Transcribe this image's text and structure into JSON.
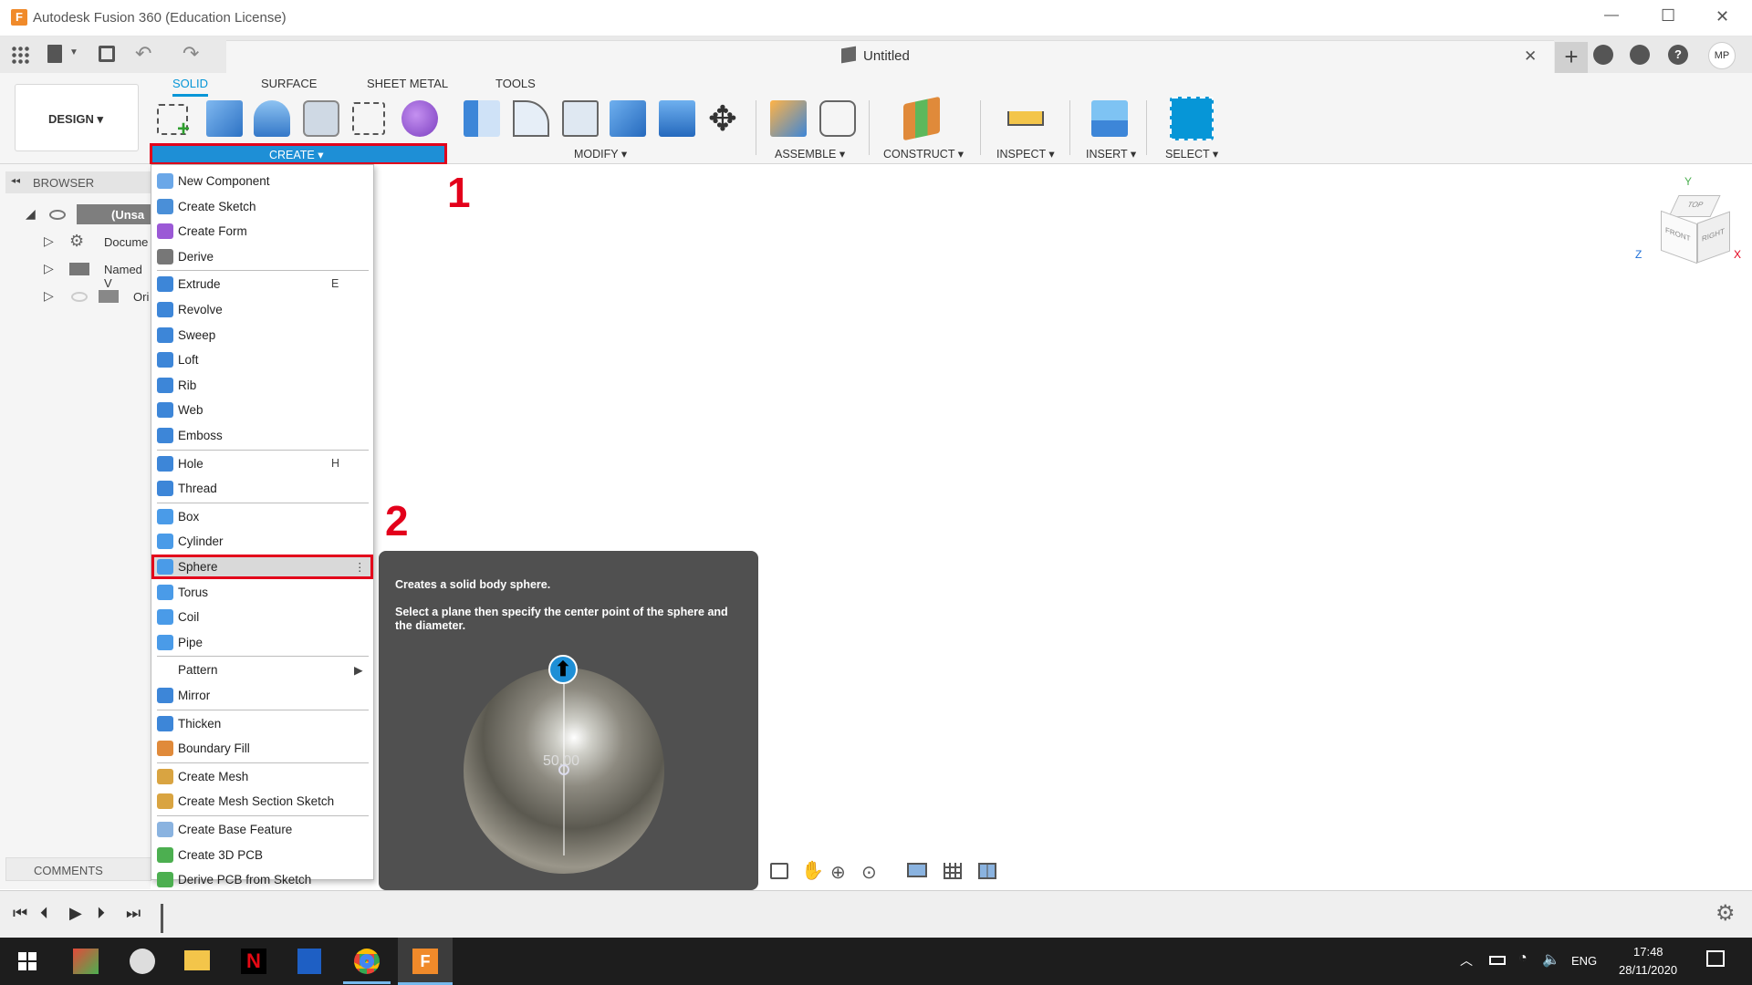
{
  "window": {
    "title": "Autodesk Fusion 360 (Education License)",
    "min": "—",
    "max": "☐",
    "close": "✕"
  },
  "document": {
    "name": "Untitled",
    "close": "✕"
  },
  "header_right": {
    "new_tab": "+",
    "user": "MP",
    "help": "?"
  },
  "workspace": {
    "label": "DESIGN ▾"
  },
  "ribbon": {
    "tabs": [
      "SOLID",
      "SURFACE",
      "SHEET METAL",
      "TOOLS"
    ],
    "active_tab": "SOLID",
    "groups": {
      "create": "CREATE ▾",
      "modify": "MODIFY ▾",
      "assemble": "ASSEMBLE ▾",
      "construct": "CONSTRUCT ▾",
      "inspect": "INSPECT ▾",
      "insert": "INSERT ▾",
      "select": "SELECT ▾"
    }
  },
  "browser": {
    "title": "BROWSER",
    "collapse": "◂◂",
    "items": [
      {
        "label": "(Unsa"
      },
      {
        "label": "Docume"
      },
      {
        "label": "Named V"
      },
      {
        "label": "Ori"
      }
    ]
  },
  "comments": {
    "label": "COMMENTS"
  },
  "create_menu": {
    "items": [
      {
        "label": "New Component",
        "shortcut": "",
        "icon": "new-component-icon",
        "color": "#6aa7e8"
      },
      {
        "label": "Create Sketch",
        "shortcut": "",
        "icon": "create-sketch-icon",
        "color": "#4a8fd8"
      },
      {
        "label": "Create Form",
        "shortcut": "",
        "icon": "create-form-icon",
        "color": "#9b59d6"
      },
      {
        "label": "Derive",
        "shortcut": "",
        "icon": "derive-icon",
        "color": "#777777"
      },
      {
        "label": "Extrude",
        "shortcut": "E",
        "icon": "extrude-icon",
        "color": "#3d86d8"
      },
      {
        "label": "Revolve",
        "shortcut": "",
        "icon": "revolve-icon",
        "color": "#3d86d8"
      },
      {
        "label": "Sweep",
        "shortcut": "",
        "icon": "sweep-icon",
        "color": "#3d86d8"
      },
      {
        "label": "Loft",
        "shortcut": "",
        "icon": "loft-icon",
        "color": "#3d86d8"
      },
      {
        "label": "Rib",
        "shortcut": "",
        "icon": "rib-icon",
        "color": "#3d86d8"
      },
      {
        "label": "Web",
        "shortcut": "",
        "icon": "web-icon",
        "color": "#3d86d8"
      },
      {
        "label": "Emboss",
        "shortcut": "",
        "icon": "emboss-icon",
        "color": "#3d86d8"
      },
      {
        "label": "Hole",
        "shortcut": "H",
        "icon": "hole-icon",
        "color": "#3d86d8"
      },
      {
        "label": "Thread",
        "shortcut": "",
        "icon": "thread-icon",
        "color": "#3d86d8"
      },
      {
        "label": "Box",
        "shortcut": "",
        "icon": "box-icon",
        "color": "#4a9be8"
      },
      {
        "label": "Cylinder",
        "shortcut": "",
        "icon": "cylinder-icon",
        "color": "#4a9be8"
      },
      {
        "label": "Sphere",
        "shortcut": "⋮",
        "icon": "sphere-icon",
        "color": "#4a9be8"
      },
      {
        "label": "Torus",
        "shortcut": "",
        "icon": "torus-icon",
        "color": "#4a9be8"
      },
      {
        "label": "Coil",
        "shortcut": "",
        "icon": "coil-icon",
        "color": "#4a9be8"
      },
      {
        "label": "Pipe",
        "shortcut": "",
        "icon": "pipe-icon",
        "color": "#4a9be8"
      },
      {
        "label": "Pattern",
        "shortcut": "▶",
        "icon": "pattern-icon",
        "color": "#ffffff"
      },
      {
        "label": "Mirror",
        "shortcut": "",
        "icon": "mirror-icon",
        "color": "#3d86d8"
      },
      {
        "label": "Thicken",
        "shortcut": "",
        "icon": "thicken-icon",
        "color": "#3d86d8"
      },
      {
        "label": "Boundary Fill",
        "shortcut": "",
        "icon": "boundary-fill-icon",
        "color": "#e08a3a"
      },
      {
        "label": "Create Mesh",
        "shortcut": "",
        "icon": "create-mesh-icon",
        "color": "#d9a441"
      },
      {
        "label": "Create Mesh Section Sketch",
        "shortcut": "",
        "icon": "mesh-section-icon",
        "color": "#d9a441"
      },
      {
        "label": "Create Base Feature",
        "shortcut": "",
        "icon": "base-feature-icon",
        "color": "#8ab3e0"
      },
      {
        "label": "Create 3D PCB",
        "shortcut": "",
        "icon": "pcb-3d-icon",
        "color": "#4caf50"
      },
      {
        "label": "Derive PCB from Sketch",
        "shortcut": "",
        "icon": "derive-pcb-icon",
        "color": "#4caf50"
      }
    ]
  },
  "tooltip": {
    "title": "Creates a solid body sphere.",
    "body": "Select a plane then specify the center point of the sphere and the diameter.",
    "dimension": "50.00"
  },
  "annotations": {
    "step1": "1",
    "step2": "2"
  },
  "viewcube": {
    "top": "TOP",
    "front": "FRONT",
    "right": "RIGHT",
    "x": "X",
    "y": "Y",
    "z": "Z"
  },
  "taskbar": {
    "lang": "ENG",
    "time": "17:48",
    "date": "28/11/2020"
  }
}
